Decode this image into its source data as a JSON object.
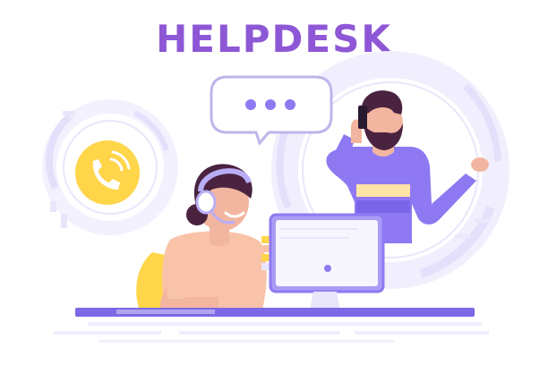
{
  "title": "HELPDESK",
  "colors": {
    "title": "#8e57d6",
    "purple": "#8f79f2",
    "purple_dark": "#6f58d8",
    "purple_light": "#eceaff",
    "ring": "#e9e6fb",
    "phone_yellow": "#ffd54a",
    "skin": "#f2b6a0",
    "hair": "#4a2340",
    "top_peach": "#f8c3a8",
    "monitor": "#a99cf5",
    "desk": "#7d68e6"
  },
  "icons": [
    "chat-bubble-icon",
    "phone-icon",
    "headset-icon",
    "mobile-phone-icon",
    "computer-monitor-icon"
  ]
}
